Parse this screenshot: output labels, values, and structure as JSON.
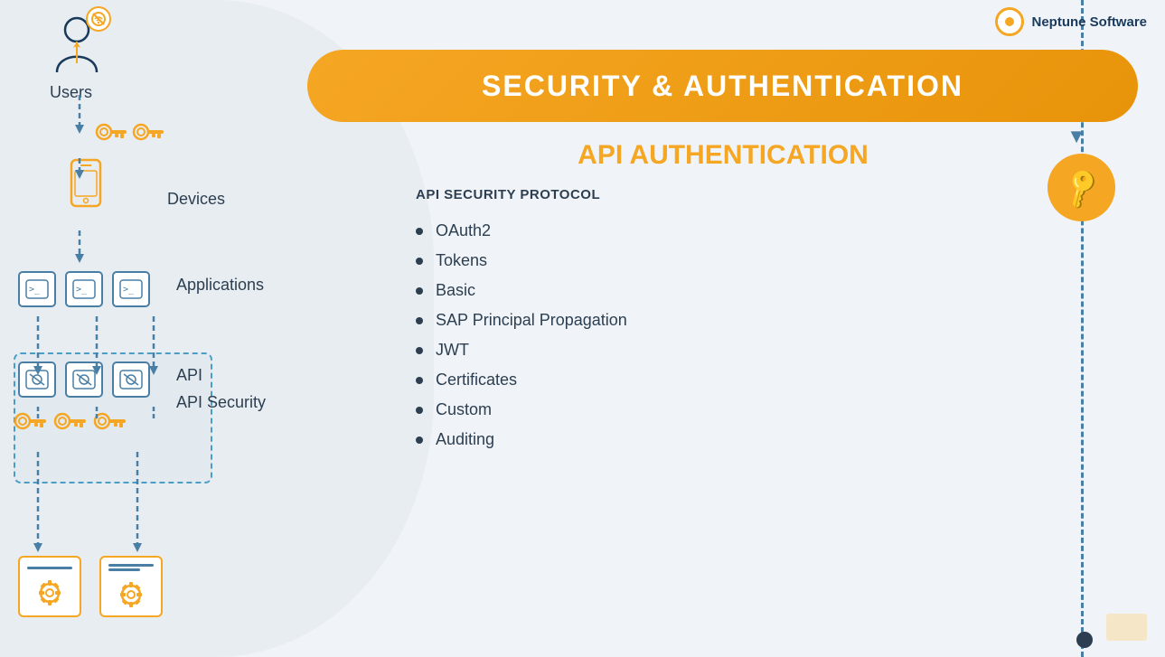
{
  "brand": {
    "name": "Neptune Software"
  },
  "header": {
    "title": "SECURITY & AUTHENTICATION"
  },
  "diagram": {
    "users_label": "Users",
    "devices_label": "Devices",
    "applications_label": "Applications",
    "api_label": "API",
    "api_security_label": "API Security"
  },
  "content": {
    "api_auth_title": "API AUTHENTICATION",
    "protocol_label": "API SECURITY PROTOCOL",
    "protocols": [
      "OAuth2",
      "Tokens",
      "Basic",
      "SAP Principal Propagation",
      "JWT",
      "Certificates",
      "Custom",
      "Auditing"
    ]
  }
}
